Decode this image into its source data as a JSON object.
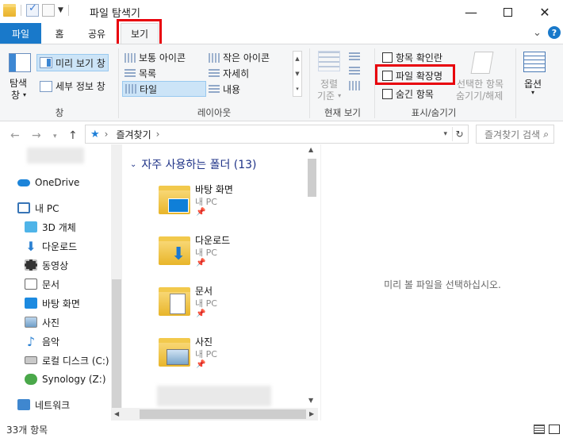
{
  "window": {
    "title": "파일 탐색기"
  },
  "tabs": [
    {
      "label": "파일"
    },
    {
      "label": "홈"
    },
    {
      "label": "공유"
    },
    {
      "label": "보기"
    }
  ],
  "ribbon": {
    "pane": {
      "nav_pane_label_1": "탐색",
      "nav_pane_label_2": "창",
      "preview_pane": "미리 보기 창",
      "details_pane": "세부 정보 창",
      "group_label": "창"
    },
    "layout": {
      "items": [
        "보통 아이콘",
        "작은 아이콘",
        "목록",
        "자세히",
        "타일",
        "내용"
      ],
      "group_label": "레이아웃"
    },
    "current_view": {
      "sort_label_1": "정렬",
      "sort_label_2": "기준",
      "group_label": "현재 보기"
    },
    "show_hide": {
      "item_checkboxes": "항목 확인란",
      "file_extensions": "파일 확장명",
      "hidden_items": "숨긴 항목",
      "hide_selected_1": "선택한 항목",
      "hide_selected_2": "숨기기/해제",
      "group_label": "표시/숨기기"
    },
    "options": {
      "label": "옵션"
    }
  },
  "address": {
    "path": "즐겨찾기",
    "separator": "›",
    "search_placeholder": "즐겨찾기 검색"
  },
  "nav_pane": {
    "items": [
      {
        "label": "OneDrive"
      },
      {
        "label": "내 PC"
      },
      {
        "label": "3D 개체"
      },
      {
        "label": "다운로드"
      },
      {
        "label": "동영상"
      },
      {
        "label": "문서"
      },
      {
        "label": "바탕 화면"
      },
      {
        "label": "사진"
      },
      {
        "label": "음악"
      },
      {
        "label": "로컬 디스크 (C:)"
      },
      {
        "label": "Synology (Z:)"
      },
      {
        "label": "네트워크"
      }
    ]
  },
  "content": {
    "group_header": "자주 사용하는 폴더 (13)",
    "tiles": [
      {
        "name": "바탕 화면",
        "location": "내 PC"
      },
      {
        "name": "다운로드",
        "location": "내 PC"
      },
      {
        "name": "문서",
        "location": "내 PC"
      },
      {
        "name": "사진",
        "location": "내 PC"
      }
    ]
  },
  "preview": {
    "empty_text": "미리 볼 파일을 선택하십시오."
  },
  "status": {
    "item_count": "33개 항목"
  }
}
